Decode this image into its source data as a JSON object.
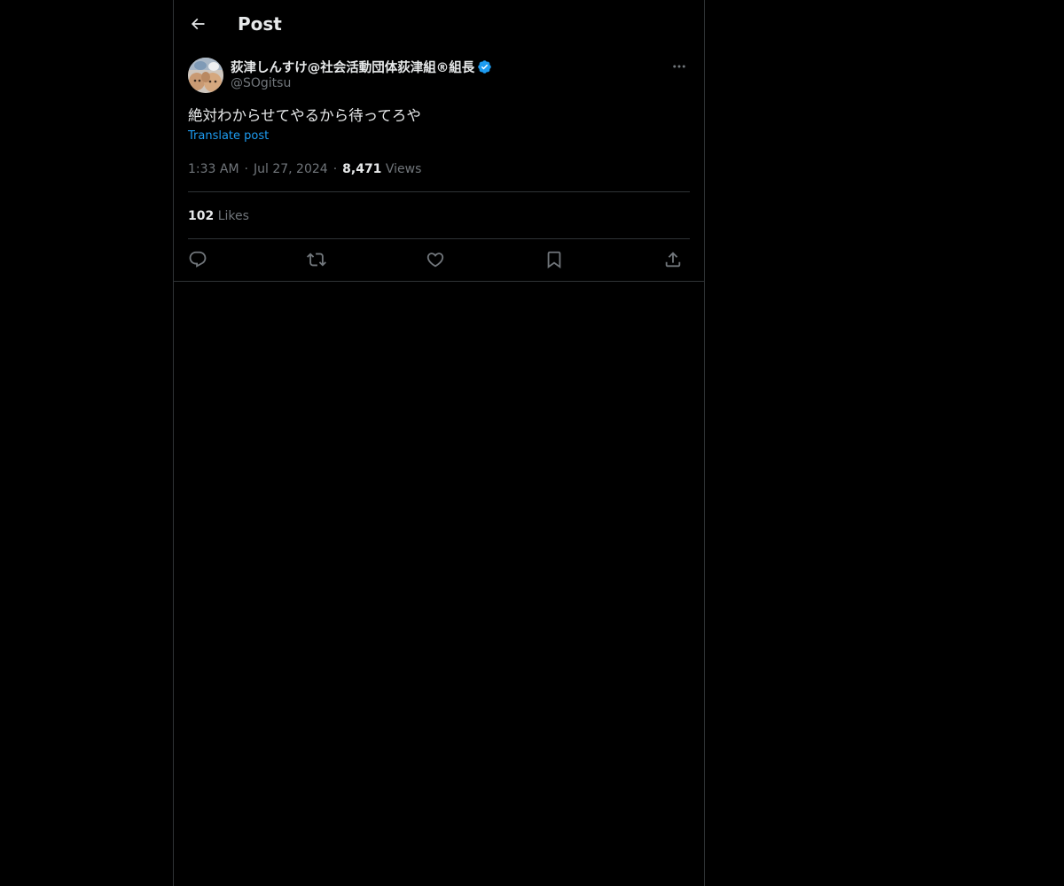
{
  "header": {
    "title": "Post",
    "back_icon": "arrow-left-icon"
  },
  "author": {
    "display_name": "荻津しんすけ@社会活動団体荻津組®組長",
    "handle": "@SOgitsu",
    "verified_icon": "verified-badge-icon",
    "verified_color": "#1d9bf0"
  },
  "post": {
    "text": "絶対わからせてやるから待ってろや",
    "translate_label": "Translate post",
    "time": "1:33 AM",
    "date": "Jul 27, 2024",
    "views_count": "8,471",
    "views_label": "Views"
  },
  "stats": {
    "likes_count": "102",
    "likes_label": "Likes"
  },
  "actions": [
    {
      "name": "reply",
      "icon": "reply-icon"
    },
    {
      "name": "repost",
      "icon": "repost-icon"
    },
    {
      "name": "like",
      "icon": "heart-icon"
    },
    {
      "name": "bookmark",
      "icon": "bookmark-icon"
    },
    {
      "name": "share",
      "icon": "share-icon"
    }
  ],
  "colors": {
    "background": "#000000",
    "text": "#e7e9ea",
    "secondary": "#71767b",
    "link": "#1d9bf0",
    "border": "#2f3336"
  }
}
